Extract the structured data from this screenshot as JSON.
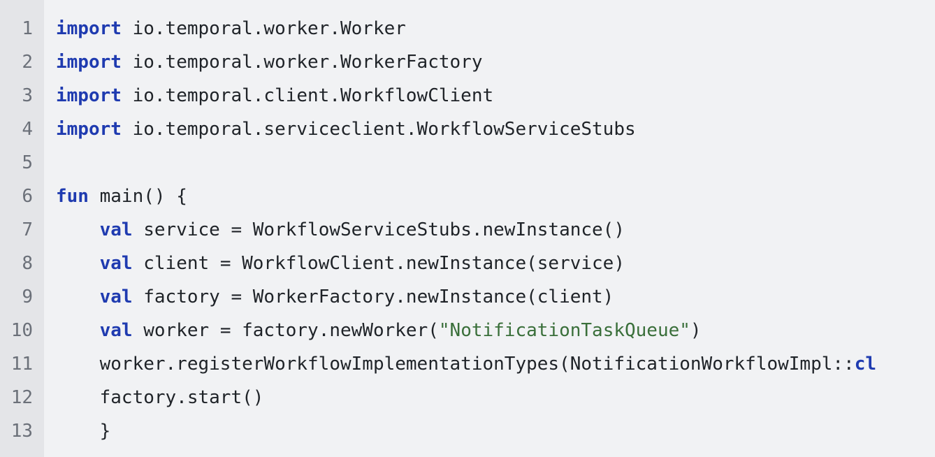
{
  "editor": {
    "colors": {
      "background": "#f1f2f4",
      "gutter_background": "#e4e5e8",
      "line_number": "#6b7079",
      "keyword": "#1f3bb0",
      "string": "#3a6f3a",
      "plain": "#1f2328"
    },
    "lines": [
      {
        "number": "1",
        "tokens": [
          {
            "type": "keyword",
            "text": "import"
          },
          {
            "type": "plain",
            "text": " io.temporal.worker.Worker"
          }
        ]
      },
      {
        "number": "2",
        "tokens": [
          {
            "type": "keyword",
            "text": "import"
          },
          {
            "type": "plain",
            "text": " io.temporal.worker.WorkerFactory"
          }
        ]
      },
      {
        "number": "3",
        "tokens": [
          {
            "type": "keyword",
            "text": "import"
          },
          {
            "type": "plain",
            "text": " io.temporal.client.WorkflowClient"
          }
        ]
      },
      {
        "number": "4",
        "tokens": [
          {
            "type": "keyword",
            "text": "import"
          },
          {
            "type": "plain",
            "text": " io.temporal.serviceclient.WorkflowServiceStubs"
          }
        ]
      },
      {
        "number": "5",
        "tokens": []
      },
      {
        "number": "6",
        "tokens": [
          {
            "type": "keyword",
            "text": "fun"
          },
          {
            "type": "plain",
            "text": " main() {"
          }
        ]
      },
      {
        "number": "7",
        "tokens": [
          {
            "type": "plain",
            "text": "    "
          },
          {
            "type": "keyword",
            "text": "val"
          },
          {
            "type": "plain",
            "text": " service = WorkflowServiceStubs.newInstance()"
          }
        ]
      },
      {
        "number": "8",
        "tokens": [
          {
            "type": "plain",
            "text": "    "
          },
          {
            "type": "keyword",
            "text": "val"
          },
          {
            "type": "plain",
            "text": " client = WorkflowClient.newInstance(service)"
          }
        ]
      },
      {
        "number": "9",
        "tokens": [
          {
            "type": "plain",
            "text": "    "
          },
          {
            "type": "keyword",
            "text": "val"
          },
          {
            "type": "plain",
            "text": " factory = WorkerFactory.newInstance(client)"
          }
        ]
      },
      {
        "number": "10",
        "tokens": [
          {
            "type": "plain",
            "text": "    "
          },
          {
            "type": "keyword",
            "text": "val"
          },
          {
            "type": "plain",
            "text": " worker = factory.newWorker("
          },
          {
            "type": "string",
            "text": "\"NotificationTaskQueue\""
          },
          {
            "type": "plain",
            "text": ")"
          }
        ]
      },
      {
        "number": "11",
        "tokens": [
          {
            "type": "plain",
            "text": "    worker.registerWorkflowImplementationTypes(NotificationWorkflowImpl::"
          },
          {
            "type": "keyword",
            "text": "cl"
          }
        ]
      },
      {
        "number": "12",
        "tokens": [
          {
            "type": "plain",
            "text": "    factory.start()"
          }
        ]
      },
      {
        "number": "13",
        "tokens": [
          {
            "type": "plain",
            "text": "    }"
          }
        ]
      }
    ]
  }
}
